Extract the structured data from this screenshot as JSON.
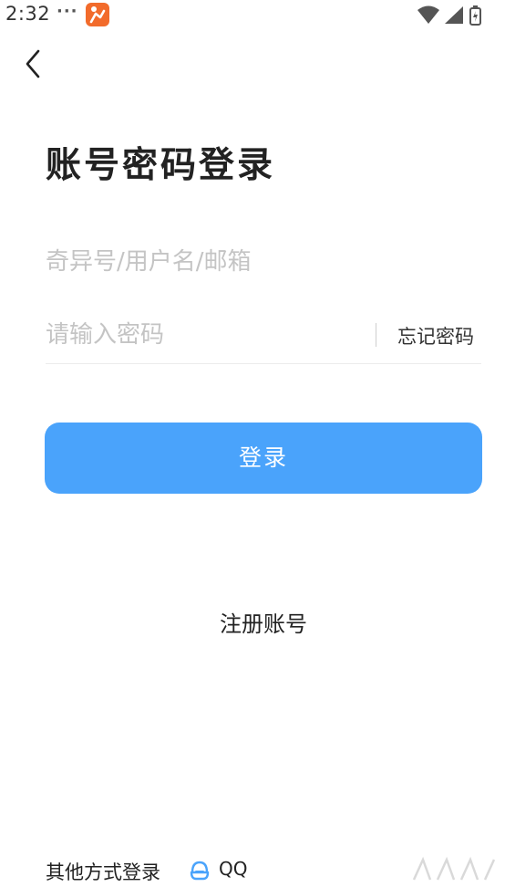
{
  "status_bar": {
    "time": "2:32",
    "dots": "···",
    "icons": [
      "app-badge-icon",
      "wifi-icon",
      "signal-icon",
      "battery-icon"
    ]
  },
  "header": {
    "back_icon": "chevron-left-icon"
  },
  "title": "账号密码登录",
  "form": {
    "account_placeholder": "奇异号/用户名/邮箱",
    "account_value": "",
    "password_placeholder": "请输入密码",
    "password_value": "",
    "forgot_label": "忘记密码"
  },
  "login_button_label": "登录",
  "register_label": "注册账号",
  "other_login": {
    "label": "其他方式登录",
    "qq_label": "QQ",
    "qq_icon": "qq-icon"
  },
  "colors": {
    "accent": "#4aa3fb",
    "placeholder": "#c4c4c4",
    "app_badge": "#f26b2b"
  }
}
